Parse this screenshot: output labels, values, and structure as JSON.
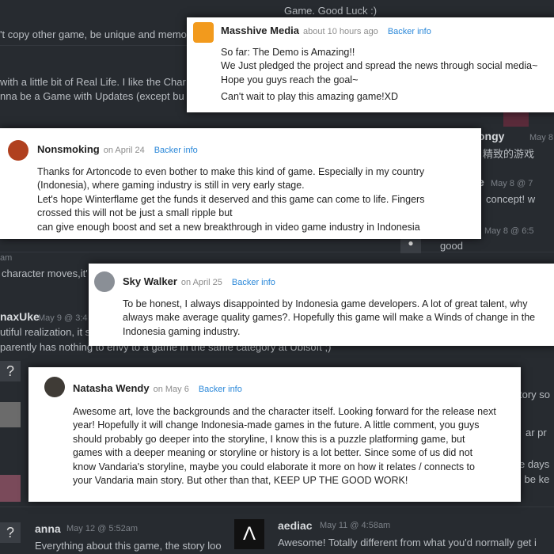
{
  "background": {
    "texts": [
      "Game. Good Luck :)",
      "'t copy other game, be unique and memo",
      "with a little bit of Real Life. I like the Char",
      "nna be a Game with Updates (except bu",
      "ongy",
      "May 8",
      "精致的游戏",
      "e",
      "May 8 @ 7",
      "concept! w",
      "May 8 @ 6:5",
      "good",
      "am",
      "character moves,it'",
      "naxUke",
      "May 9 @ 3:4",
      "utiful realization, it s",
      "parently has nothing to envy to a game in the same category at Ubisoft ;)",
      "tory so",
      "ar pr",
      "e days",
      "l be ke",
      "anna",
      "May 12 @ 5:52am",
      "Everything about this game, the story loo",
      "aediac",
      "May 11 @ 4:58am",
      "Awesome! Totally different from what you'd normally get i"
    ]
  },
  "comments": [
    {
      "name": "Masshive Media",
      "time": "about 10 hours ago",
      "backer": "Backer info",
      "lines": [
        "So far: The Demo is Amazing!!",
        "We Just pledged the project and spread the news through social media~",
        "Hope you guys reach the goal~",
        "Can't wait to play this amazing game!XD"
      ]
    },
    {
      "name": "Nonsmoking",
      "time": "on April 24",
      "backer": "Backer info",
      "lines": [
        "Thanks for Artoncode to even bother to make this kind of game. Especially in my country",
        "(Indonesia), where gaming industry is still in very early stage.",
        "Let's hope Winterflame get the funds it deserved and this game can come to life. Fingers",
        "crossed this will not be just a small ripple but",
        "can give enough boost and set a new breakthrough in video game industry in Indonesia"
      ]
    },
    {
      "name": "Sky Walker",
      "time": "on April 25",
      "backer": "Backer info",
      "lines": [
        "To be honest, I always disappointed by Indonesia game developers. A lot of great talent, why",
        "always make average quality games?. Hopefully this game will make a Winds of change in the",
        "Indonesia gaming industry."
      ]
    },
    {
      "name": "Natasha Wendy",
      "time": "on May 6",
      "backer": "Backer info",
      "lines": [
        "Awesome art, love the backgrounds and the character itself. Looking forward for the release next",
        "year! Hopefully it will change Indonesia-made games in the future. A little comment, you guys",
        "should probably go deeper into the storyline, I know this is a puzzle platforming game, but",
        "games with a deeper meaning or storyline or history is a lot better. Since some of us did not",
        "know Vandaria's storyline, maybe you could elaborate it more on how it relates / connects to",
        "your Vandaria main story. But other than that, KEEP UP THE GOOD WORK!"
      ]
    }
  ],
  "colors": {
    "background": "#272b30",
    "card": "#ffffff",
    "link": "#2b88d9"
  }
}
